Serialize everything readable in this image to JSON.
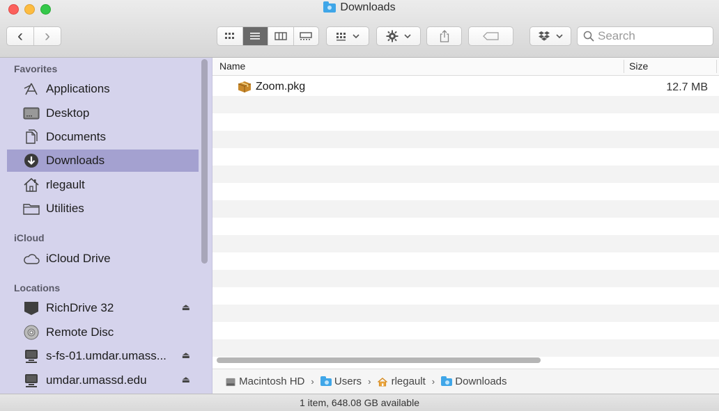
{
  "window": {
    "title": "Downloads"
  },
  "toolbar": {
    "back_label": "‹",
    "forward_label": "›",
    "search_placeholder": "Search"
  },
  "sidebar": {
    "favorites_header": "Favorites",
    "favorites": [
      {
        "label": "Applications",
        "icon": "applications-icon"
      },
      {
        "label": "Desktop",
        "icon": "desktop-icon"
      },
      {
        "label": "Documents",
        "icon": "documents-icon"
      },
      {
        "label": "Downloads",
        "icon": "downloads-icon",
        "selected": true
      },
      {
        "label": "rlegault",
        "icon": "home-icon"
      },
      {
        "label": "Utilities",
        "icon": "folder-icon"
      }
    ],
    "icloud_header": "iCloud",
    "icloud": [
      {
        "label": "iCloud Drive",
        "icon": "cloud-icon"
      }
    ],
    "locations_header": "Locations",
    "locations": [
      {
        "label": "RichDrive 32",
        "icon": "drive-icon",
        "eject": true
      },
      {
        "label": "Remote Disc",
        "icon": "disc-icon",
        "eject": false
      },
      {
        "label": "s-fs-01.umdar.umass...",
        "icon": "server-icon",
        "eject": true
      },
      {
        "label": "umdar.umassd.edu",
        "icon": "server-icon",
        "eject": true
      }
    ]
  },
  "list": {
    "columns": {
      "name": "Name",
      "size": "Size"
    },
    "files": [
      {
        "name": "Zoom.pkg",
        "size": "12.7 MB",
        "icon": "package-icon"
      }
    ]
  },
  "pathbar": {
    "items": [
      "Macintosh HD",
      "Users",
      "rlegault",
      "Downloads"
    ]
  },
  "status": {
    "text": "1 item, 648.08 GB available"
  },
  "colors": {
    "sidebar_bg": "#d5d3ec",
    "sidebar_selected": "#a4a1d0",
    "folder_blue": "#3fa6e8"
  }
}
